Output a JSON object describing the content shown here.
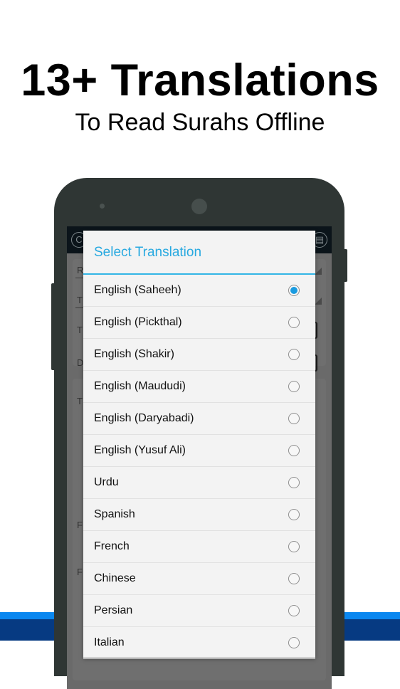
{
  "promo": {
    "headline": "13+ Translations",
    "subheadline": "To Read Surahs Offline"
  },
  "app_bar": {
    "left_icon": "refresh-icon",
    "left_glyph": "C",
    "right_icon": "save-icon",
    "right_glyph": "▤"
  },
  "background_form": {
    "labels": [
      "R",
      "T",
      "T",
      "D",
      "T",
      "F",
      "F"
    ]
  },
  "dialog": {
    "title": "Select Translation",
    "accent_color": "#33b5e5",
    "selected_index": 0,
    "options": [
      {
        "label": "English (Saheeh)",
        "checked": true
      },
      {
        "label": "English (Pickthal)",
        "checked": false
      },
      {
        "label": "English (Shakir)",
        "checked": false
      },
      {
        "label": "English (Maududi)",
        "checked": false
      },
      {
        "label": "English (Daryabadi)",
        "checked": false
      },
      {
        "label": "English (Yusuf Ali)",
        "checked": false
      },
      {
        "label": "Urdu",
        "checked": false
      },
      {
        "label": "Spanish",
        "checked": false
      },
      {
        "label": "French",
        "checked": false
      },
      {
        "label": "Chinese",
        "checked": false
      },
      {
        "label": "Persian",
        "checked": false
      },
      {
        "label": "Italian",
        "checked": false
      }
    ]
  },
  "colors": {
    "band_light": "#0a87f0",
    "band_dark": "#063a82",
    "phone_body": "#2f3634"
  }
}
